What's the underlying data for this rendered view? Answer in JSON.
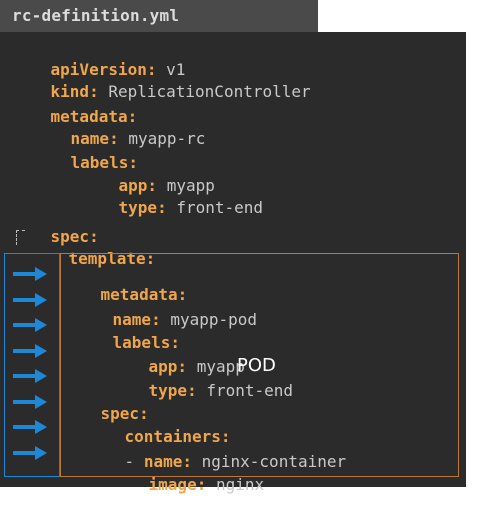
{
  "file": {
    "tab_title": "rc-definition.yml"
  },
  "code": {
    "line01": {
      "key": "apiVersion:",
      "value": "v1"
    },
    "line02": {
      "key": "kind:",
      "value": "ReplicationController"
    },
    "line03": {
      "key": "metadata:"
    },
    "line04": {
      "key": "name:",
      "value": "myapp-rc"
    },
    "line05": {
      "key": "labels:"
    },
    "line06": {
      "key": "app:",
      "value": "myapp"
    },
    "line07": {
      "key": "type:",
      "value": "front-end"
    },
    "line08": {
      "key": "spec:"
    },
    "line09": {
      "key": "template:"
    },
    "line10": {
      "key": "metadata:"
    },
    "line11": {
      "key": "name:",
      "value": "myapp-pod"
    },
    "line12": {
      "key": "labels:"
    },
    "line13": {
      "key": "app:",
      "value": "myapp"
    },
    "line14": {
      "key": "type:",
      "value": "front-end"
    },
    "line15": {
      "key": "spec:"
    },
    "line16": {
      "key": "containers:"
    },
    "line17": {
      "dash": "-",
      "key": "name:",
      "value": "nginx-container"
    },
    "line18": {
      "key": "image:",
      "value": "nginx"
    }
  },
  "annotation": {
    "pod_label": "POD",
    "box_color": "#b9783a",
    "arrow_color": "#1e88d8",
    "arrow_count": 8
  }
}
